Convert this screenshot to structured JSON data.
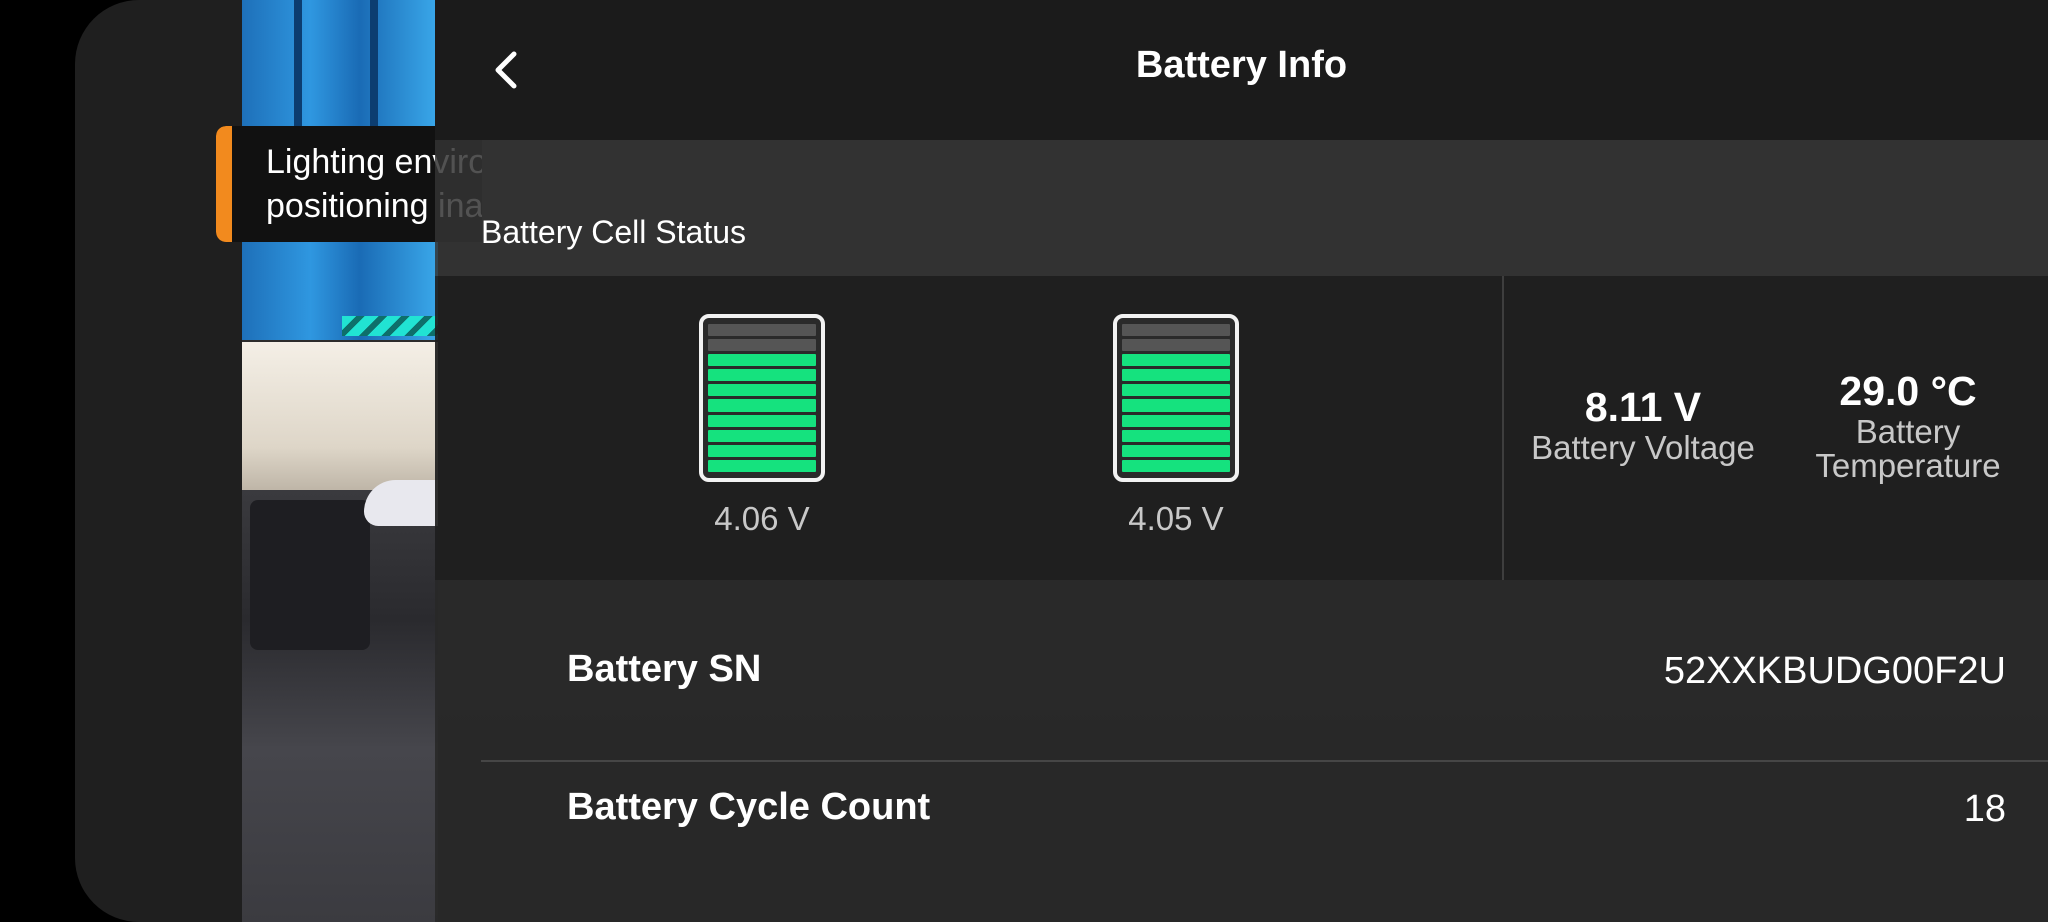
{
  "header": {
    "title": "Battery Info",
    "back_icon": "chevron-left-icon"
  },
  "toast": {
    "message": "Lighting environment too dark. Visual\npositioning inaccurate. Fly with caution",
    "accent_color": "#f28a1e"
  },
  "cell_status": {
    "section_label": "Battery Cell Status",
    "cells": [
      {
        "voltage": "4.06 V",
        "level_fraction": 0.8
      },
      {
        "voltage": "4.05 V",
        "level_fraction": 0.8
      }
    ]
  },
  "stats": {
    "voltage": {
      "value": "8.11 V",
      "label": "Battery Voltage"
    },
    "temperature": {
      "value": "29.0 °C",
      "label": "Battery\nTemperature"
    }
  },
  "details": {
    "rows": [
      {
        "label": "Battery SN",
        "value": "52XXKBUDG00F2U"
      },
      {
        "label": "Battery Cycle Count",
        "value": "18"
      }
    ]
  },
  "colors": {
    "cell_fill": "#15e27e",
    "header_bg": "#1b1b1b"
  }
}
